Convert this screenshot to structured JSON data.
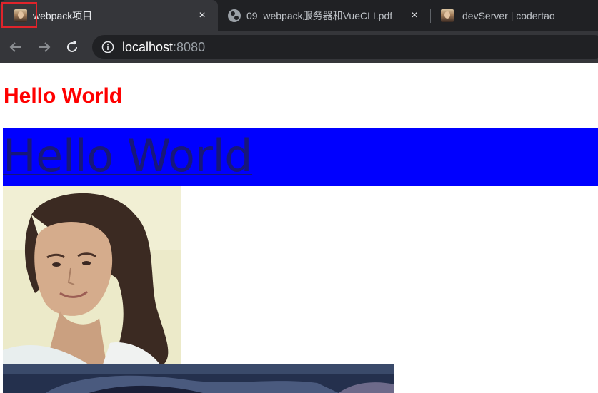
{
  "browser": {
    "tabs": [
      {
        "title": "webpack项目",
        "favicon": "portrait-favicon",
        "active": true
      },
      {
        "title": "09_webpack服务器和VueCLI.pdf",
        "favicon": "globe-icon",
        "active": false
      },
      {
        "title": "devServer | codertao",
        "favicon": "portrait-favicon",
        "active": false
      }
    ],
    "close_glyph": "×",
    "address": {
      "host": "localhost",
      "port": ":8080"
    },
    "icons": [
      "back-arrow-icon",
      "forward-arrow-icon",
      "reload-icon",
      "info-icon",
      "close-icon"
    ]
  },
  "page": {
    "heading": "Hello World",
    "banner_link": "Hello World",
    "colors": {
      "heading": "#ff0000",
      "banner_background": "#0000ff",
      "banner_link": "#17177a",
      "highlight_box": "#e0242b"
    }
  }
}
